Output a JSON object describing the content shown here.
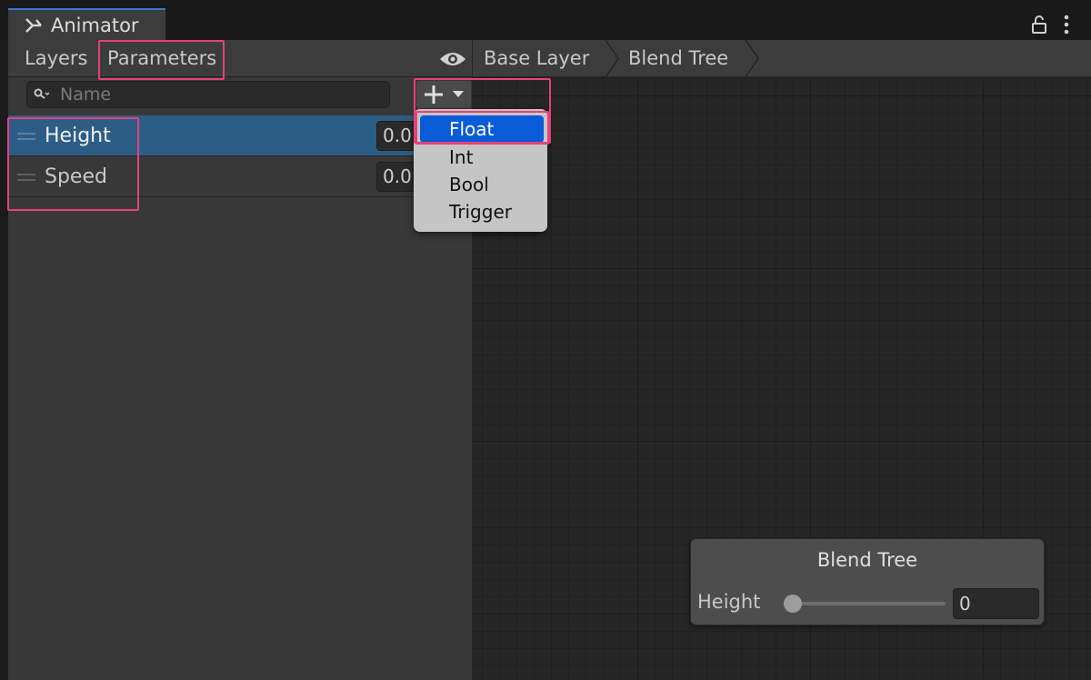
{
  "window": {
    "tab_title": "Animator"
  },
  "left_panel": {
    "tabs": [
      {
        "label": "Layers"
      },
      {
        "label": "Parameters"
      }
    ],
    "search": {
      "placeholder": "Name"
    },
    "parameters": [
      {
        "name": "Height",
        "value": "0.0",
        "selected": true
      },
      {
        "name": "Speed",
        "value": "0.0",
        "selected": false
      }
    ]
  },
  "add_menu": {
    "items": [
      {
        "label": "Float",
        "highlighted": true
      },
      {
        "label": "Int"
      },
      {
        "label": "Bool"
      },
      {
        "label": "Trigger"
      }
    ]
  },
  "breadcrumb": [
    {
      "label": "Base Layer"
    },
    {
      "label": "Blend Tree"
    }
  ],
  "node": {
    "title": "Blend Tree",
    "param_label": "Height",
    "value": "0",
    "slider_fraction": 0
  },
  "colors": {
    "selection": "#2c5d87",
    "menu_highlight": "#0a5bd8",
    "annotation": "#e6407a",
    "tab_accent": "#3b78d4"
  }
}
